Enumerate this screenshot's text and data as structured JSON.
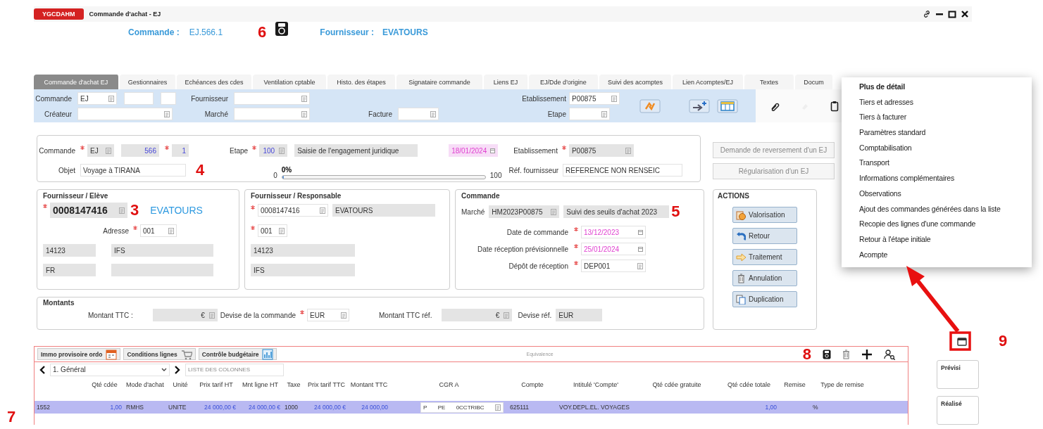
{
  "window": {
    "badge": "YGCDAHM",
    "title": "Commande d'achat - EJ"
  },
  "header": {
    "items": [
      {
        "label": "Commande :",
        "value": "EJ.566.1"
      },
      {
        "label": "Fournisseur :",
        "value": "EVATOURS"
      }
    ],
    "annotation": "6"
  },
  "tabs": [
    {
      "label": "Commande d'achat EJ",
      "selected": true
    },
    {
      "label": "Gestionnaires",
      "selected": false
    },
    {
      "label": "Echéances des cdes",
      "selected": false
    },
    {
      "label": "Ventilation cptable",
      "selected": false
    },
    {
      "label": "Histo. des étapes",
      "selected": false
    },
    {
      "label": "Signataire commande",
      "selected": false
    },
    {
      "label": "Liens EJ",
      "selected": false
    },
    {
      "label": "EJ/Dde d'origine",
      "selected": false
    },
    {
      "label": "Suivi des acomptes",
      "selected": false
    },
    {
      "label": "Lien Acomptes/EJ",
      "selected": false
    },
    {
      "label": "Textes",
      "selected": false
    },
    {
      "label": "Docum",
      "selected": false
    }
  ],
  "filter": {
    "fields": [
      {
        "label": "Commande",
        "value": "EJ",
        "kind": "lookup"
      },
      {
        "label": "Fournisseur",
        "kind": "lookup"
      },
      {
        "label": "Etablissement",
        "value": "P00875",
        "kind": "lookup"
      },
      {
        "label": "Créateur",
        "kind": "lookup"
      },
      {
        "label": "Marché",
        "kind": "lookup"
      },
      {
        "label": "Facture",
        "kind": "lookup"
      },
      {
        "label": "Etape",
        "kind": "lookup"
      }
    ]
  },
  "order": {
    "fields": [
      {
        "label": "Commande",
        "value": "EJ",
        "kind": "lookup",
        "required": true,
        "readonly": true
      },
      {
        "value": "566",
        "kind": "number",
        "required": false,
        "readonly": true
      },
      {
        "value": "1",
        "kind": "number",
        "required": true,
        "readonly": true
      },
      {
        "label": "Etape",
        "value": "100",
        "kind": "code",
        "required": true,
        "readonly": true
      },
      {
        "value": "Saisie de l'engagement juridique",
        "kind": "text",
        "required": false,
        "readonly": true
      },
      {
        "value": "18/01/2024",
        "kind": "date",
        "required": false,
        "readonly": true
      },
      {
        "label": "Etablissement",
        "value": "P00875",
        "kind": "lookup",
        "required": true,
        "readonly": true
      },
      {
        "label": "Objet",
        "value": "Voyage à TIRANA",
        "kind": "text",
        "required": false,
        "readonly": false
      },
      {
        "label": "Réf. fournisseur",
        "value": "REFERENCE NON RENSEIC",
        "kind": "text",
        "required": false,
        "readonly": false
      }
    ],
    "progress": {
      "min": "0",
      "value": "0%",
      "max": "100",
      "level": 0
    },
    "annotation": "4"
  },
  "side_buttons": [
    {
      "label": "Demande de reversement d'un EJ",
      "disabled": true
    },
    {
      "label": "Régularisation d'un EJ",
      "disabled": true
    }
  ],
  "supplier": {
    "title": "Fournisseur / Elève",
    "annotation": "3",
    "fields": [
      {
        "value": "0008147416",
        "kind": "lookup",
        "required": true,
        "readonly": true
      },
      {
        "value": "EVATOURS",
        "kind": "link"
      },
      {
        "label": "Adresse",
        "value": "001",
        "kind": "lookup",
        "required": true,
        "readonly": false
      },
      {
        "value": "14123",
        "kind": "text",
        "readonly": true
      },
      {
        "value": "IFS",
        "kind": "text",
        "readonly": true
      },
      {
        "value": "FR",
        "kind": "text",
        "readonly": true
      },
      {
        "kind": "text",
        "readonly": true
      }
    ]
  },
  "responsible": {
    "title": "Fournisseur / Responsable",
    "fields": [
      {
        "value": "0008147416",
        "kind": "lookup",
        "required": true,
        "readonly": false
      },
      {
        "value": "EVATOURS",
        "kind": "text",
        "readonly": true
      },
      {
        "value": "001",
        "kind": "lookup",
        "required": true,
        "readonly": false
      },
      {
        "value": "14123",
        "kind": "text",
        "readonly": true
      },
      {
        "value": "IFS",
        "kind": "text",
        "readonly": true
      }
    ]
  },
  "commande": {
    "title": "Commande",
    "annotation": "5",
    "fields": [
      {
        "label": "Marché",
        "value": "HM2023P00875",
        "kind": "lookup",
        "required": false,
        "readonly": true
      },
      {
        "value": "Suivi des seuils d'achat 2023",
        "kind": "text",
        "required": false,
        "readonly": true
      },
      {
        "label": "Date de commande",
        "value": "13/12/2023",
        "kind": "date",
        "required": true,
        "readonly": false
      },
      {
        "label": "Date réception prévisionnelle",
        "value": "25/01/2024",
        "kind": "date",
        "required": true,
        "readonly": false
      },
      {
        "label": "Dépôt de réception",
        "value": "DEP001",
        "kind": "lookup",
        "required": true,
        "readonly": false
      }
    ]
  },
  "actions": {
    "title": "ACTIONS",
    "buttons": [
      {
        "label": "Valorisation",
        "kind": "coin"
      },
      {
        "label": "Retour",
        "kind": "undo"
      },
      {
        "label": "Traitement",
        "kind": "arrow"
      },
      {
        "label": "Annulation",
        "kind": "trash"
      },
      {
        "label": "Duplication",
        "kind": "copy"
      }
    ]
  },
  "amounts": {
    "title": "Montants",
    "fields": [
      {
        "label": "Montant TTC :",
        "kind": "amount",
        "currency": "€",
        "required": false,
        "readonly": true
      },
      {
        "label": "Devise de la commande",
        "value": "EUR",
        "kind": "lookup",
        "required": true,
        "readonly": false
      },
      {
        "label": "Montant TTC réf.",
        "kind": "amount",
        "currency": "€",
        "required": false,
        "readonly": true
      },
      {
        "label": "Devise réf.",
        "value": "EUR",
        "kind": "text",
        "required": false,
        "readonly": true
      }
    ]
  },
  "menu": {
    "items": [
      {
        "label": "Plus de détail",
        "default": true
      },
      {
        "label": "Tiers et adresses",
        "default": false
      },
      {
        "label": "Tiers à facturer",
        "default": false
      },
      {
        "label": "Paramètres standard",
        "default": false
      },
      {
        "label": "Comptabilisation",
        "default": false
      },
      {
        "label": "Transport",
        "default": false
      },
      {
        "label": "Informations complémentaires",
        "default": false
      },
      {
        "label": "Observations",
        "default": false
      },
      {
        "label": "Ajout des commandes générées dans la liste",
        "default": false
      },
      {
        "label": "Recopie des lignes d'une commande",
        "default": false
      },
      {
        "label": "Retour à l'étape initiale",
        "default": false
      },
      {
        "label": "Acompte",
        "default": false
      }
    ],
    "annotation": "9"
  },
  "lines": {
    "toolbar": [
      {
        "label": "Immo provisoire ordo",
        "kind": "calendar"
      },
      {
        "label": "Conditions lignes",
        "kind": "cart"
      },
      {
        "label": "Contrôle budgétaire",
        "kind": "chart"
      }
    ],
    "caption": "Equivalence",
    "annotation": "8",
    "view": "1. Général",
    "columns_field": "LISTE DES COLONNES",
    "columns": [
      "Qté cdée",
      "Mode d'achat",
      "Unité",
      "Prix tarif HT",
      "Mnt ligne HT",
      "Taxe",
      "Prix tarif TTC",
      "Montant TTC",
      "CGR A",
      "Compte",
      "Intitulé 'Compte'",
      "Qté cdée gratuite",
      "Qté cdée totale",
      "Remise",
      "Type de remise"
    ],
    "rows": [
      {
        "selected": true,
        "cells": {
          "column_1": "1552",
          "qte_cdee": "1,00",
          "mode_achat": "RMHS",
          "unite": "UNITE",
          "prix_tarif_ht": "24 000,00 €",
          "mnt_ligne_ht": "24 000,00 €",
          "taxe": "1000",
          "prix_tarif_ttc": "24 000,00 €",
          "montant_ttc": "24 000,00",
          "cgr_a": [
            "P",
            "PE",
            "0CCTRIBC"
          ],
          "compte": "625111",
          "intitule_compte": "VOY.DEPL.EL. VOYAGES",
          "qte_cdee_totale": "1,00",
          "type_remise": "%"
        }
      }
    ],
    "row_annotation": "7"
  },
  "side_panels": [
    "Prévisi",
    "Réalisé"
  ]
}
